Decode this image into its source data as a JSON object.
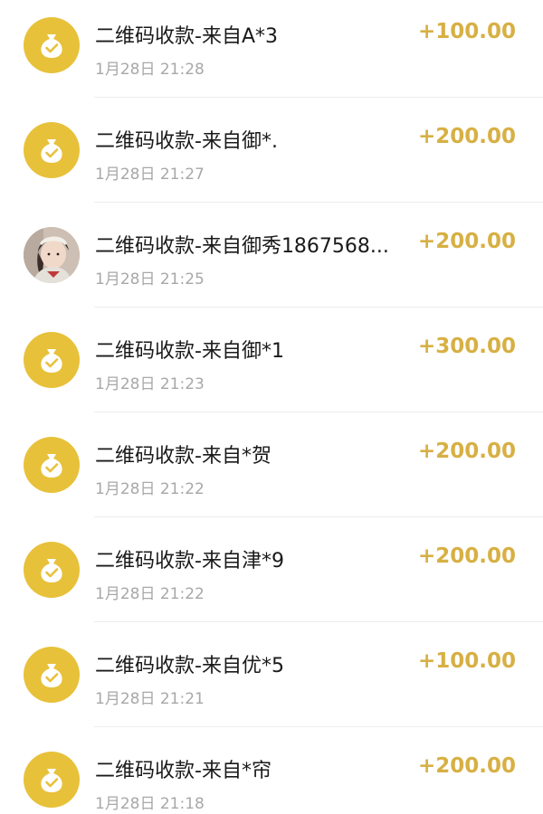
{
  "transactions": [
    {
      "title": "二维码收款-来自A*3",
      "time": "1月28日 21:28",
      "amount": "+100.00",
      "icon": "money-bag-icon"
    },
    {
      "title": "二维码收款-来自御*.",
      "time": "1月28日 21:27",
      "amount": "+200.00",
      "icon": "money-bag-icon"
    },
    {
      "title": "二维码收款-来自御秀1867568...",
      "time": "1月28日 21:25",
      "amount": "+200.00",
      "icon": "user-photo-avatar"
    },
    {
      "title": "二维码收款-来自御*1",
      "time": "1月28日 21:23",
      "amount": "+300.00",
      "icon": "money-bag-icon"
    },
    {
      "title": "二维码收款-来自*贺",
      "time": "1月28日 21:22",
      "amount": "+200.00",
      "icon": "money-bag-icon"
    },
    {
      "title": "二维码收款-来自津*9",
      "time": "1月28日 21:22",
      "amount": "+200.00",
      "icon": "money-bag-icon"
    },
    {
      "title": "二维码收款-来自优*5",
      "time": "1月28日 21:21",
      "amount": "+100.00",
      "icon": "money-bag-icon"
    },
    {
      "title": "二维码收款-来自*帘",
      "time": "1月28日 21:18",
      "amount": "+200.00",
      "icon": "money-bag-icon"
    }
  ],
  "colors": {
    "icon_bg": "#e8c13a",
    "amount": "#d7b044",
    "title": "#1a1a1a",
    "time": "#a8a8a8"
  }
}
